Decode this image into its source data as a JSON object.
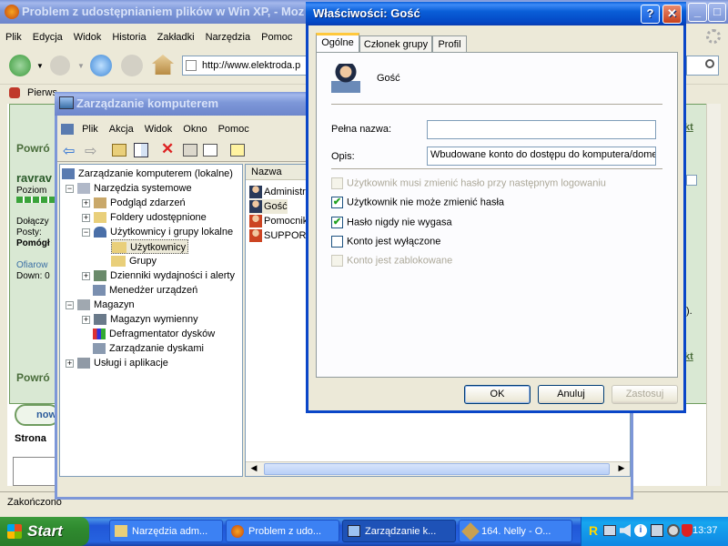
{
  "firefox": {
    "title": "Problem z udostępnianiem plików w Win XP, - Moz",
    "menu": [
      "Plik",
      "Edycja",
      "Widok",
      "Historia",
      "Zakładki",
      "Narzędzia",
      "Pomoc"
    ],
    "url": "http://www.elektroda.p",
    "bookmark": "Pierws",
    "status": "Zakończono",
    "page": {
      "powrot1": "Powró",
      "user": "ravrav",
      "poziom": "Poziom",
      "dolaczyl": "Dołączy",
      "posty": "Posty: ",
      "pomogl": "Pomógł",
      "ofiarowal": "Ofiarow",
      "down": "Down: 0",
      "powrot2": "Powró",
      "link1": "kt",
      "link2": "kt",
      "text1": ").",
      "new_btn": "now",
      "strona": "Strona"
    }
  },
  "cm": {
    "title": "Zarządzanie komputerem",
    "menu": [
      "Plik",
      "Akcja",
      "Widok",
      "Okno",
      "Pomoc"
    ],
    "tree": [
      {
        "label": "Zarządzanie komputerem (lokalne)"
      },
      {
        "label": "Narzędzia systemowe"
      },
      {
        "label": "Podgląd zdarzeń"
      },
      {
        "label": "Foldery udostępnione"
      },
      {
        "label": "Użytkownicy i grupy lokalne"
      },
      {
        "label": "Użytkownicy"
      },
      {
        "label": "Grupy"
      },
      {
        "label": "Dzienniki wydajności i alerty"
      },
      {
        "label": "Menedżer urządzeń"
      },
      {
        "label": "Magazyn"
      },
      {
        "label": "Magazyn wymienny"
      },
      {
        "label": "Defragmentator dysków"
      },
      {
        "label": "Zarządzanie dyskami"
      },
      {
        "label": "Usługi i aplikacje"
      }
    ],
    "list_header": "Nazwa",
    "list": [
      "Administra",
      "Gość",
      "Pomocnik",
      "SUPPORT_"
    ]
  },
  "dialog": {
    "title": "Właściwości: Gość",
    "tabs": [
      "Ogólne",
      "Członek grupy",
      "Profil"
    ],
    "user_name": "Gość",
    "full_name_label": "Pełna nazwa:",
    "full_name_value": "",
    "desc_label": "Opis:",
    "desc_value": "Wbudowane konto do dostępu do komputera/dome",
    "checks": [
      {
        "label": "Użytkownik musi zmienić hasło przy następnym logowaniu",
        "checked": false,
        "disabled": true
      },
      {
        "label": "Użytkownik nie może zmienić hasła",
        "checked": true,
        "disabled": false
      },
      {
        "label": "Hasło nigdy nie wygasa",
        "checked": true,
        "disabled": false
      },
      {
        "label": "Konto jest wyłączone",
        "checked": false,
        "disabled": false
      },
      {
        "label": "Konto jest zablokowane",
        "checked": false,
        "disabled": true
      }
    ],
    "ok": "OK",
    "cancel": "Anuluj",
    "apply": "Zastosuj"
  },
  "taskbar": {
    "start": "Start",
    "tasks": [
      "Narzędzia adm...",
      "Problem z udo...",
      "Zarządzanie k...",
      "164. Nelly - O..."
    ],
    "clock": "13:37"
  },
  "colors": {
    "xp_blue": "#0a5fd8",
    "face": "#ece9d8",
    "check_green": "#21a121"
  }
}
